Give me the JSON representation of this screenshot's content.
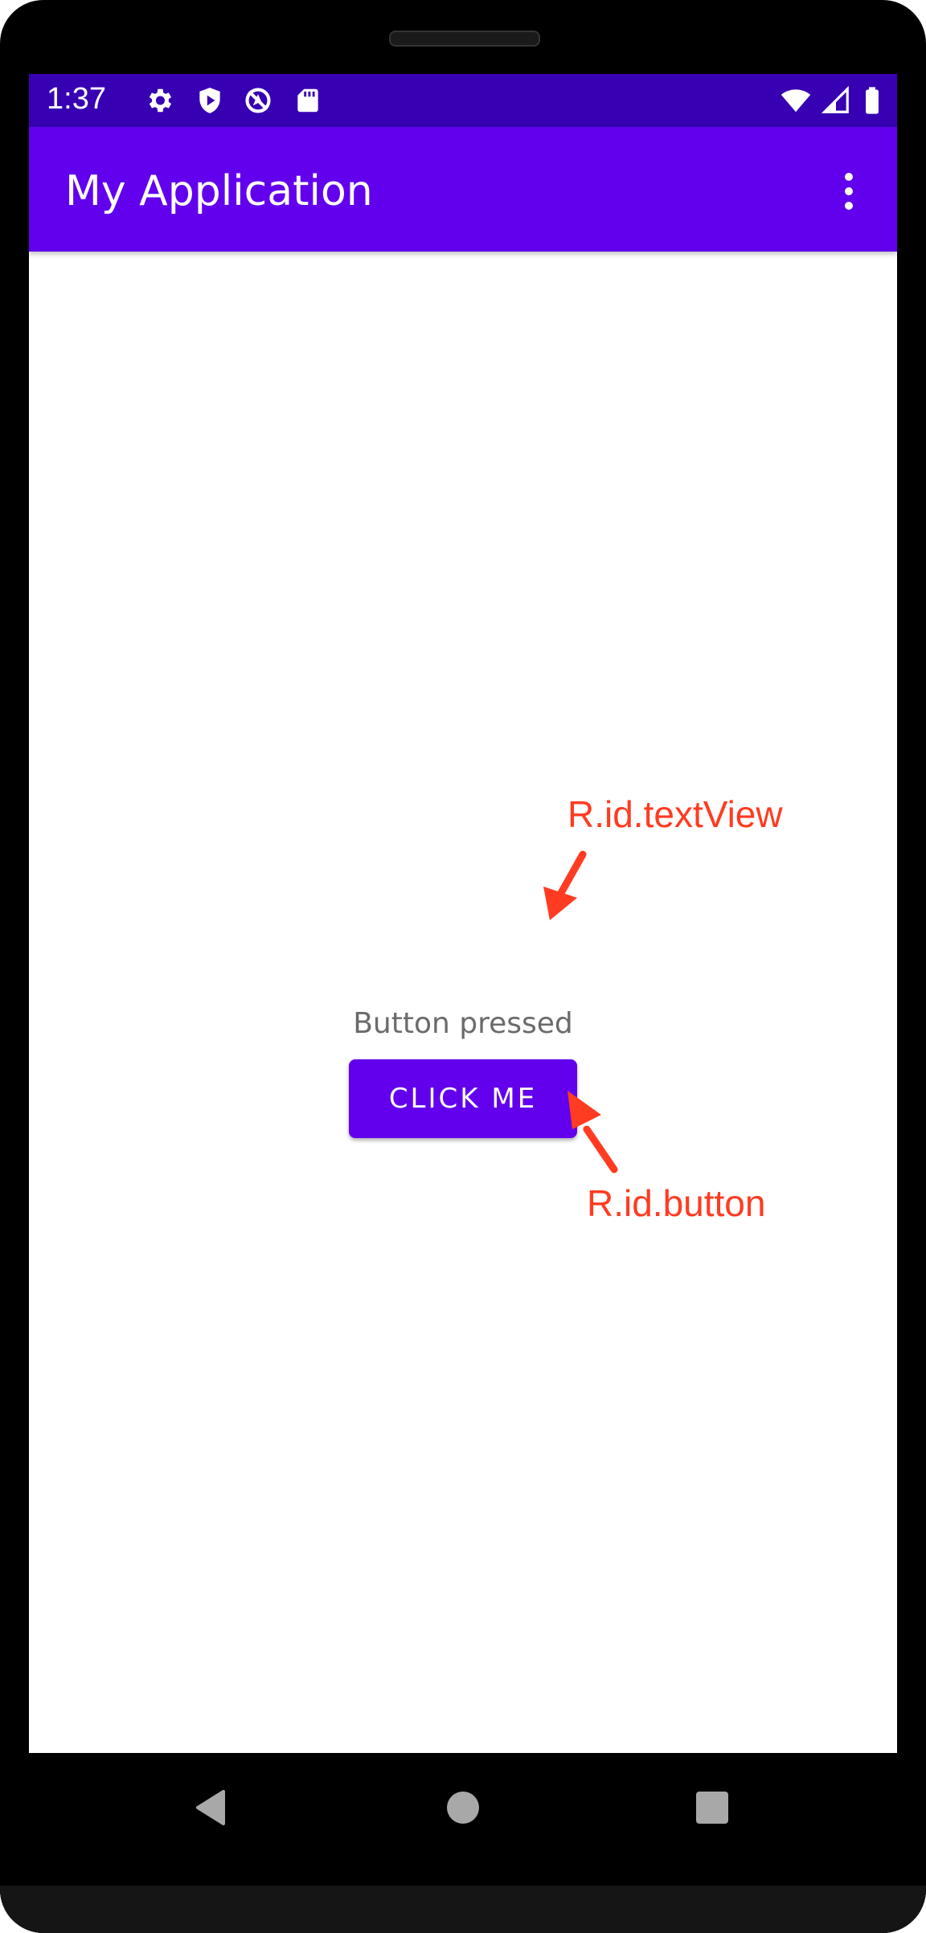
{
  "status_bar": {
    "time": "1:37",
    "icons": [
      "gear-icon",
      "shield-play-icon",
      "no-location-icon",
      "sd-card-icon",
      "wifi-icon",
      "cell-signal-icon",
      "battery-icon"
    ]
  },
  "app_bar": {
    "title": "My Application",
    "menu_icon": "more-vertical-icon"
  },
  "main": {
    "text_view": "Button pressed",
    "button_label": "CLICK ME"
  },
  "annotations": {
    "text_view_label": "R.id.textView",
    "button_label": "R.id.button",
    "color": "#ff3b22"
  },
  "nav_bar": {
    "icons": [
      "back-icon",
      "home-icon",
      "recents-icon"
    ]
  },
  "colors": {
    "status_bar": "#3700b3",
    "app_bar": "#6200ee",
    "button": "#6200ee"
  }
}
